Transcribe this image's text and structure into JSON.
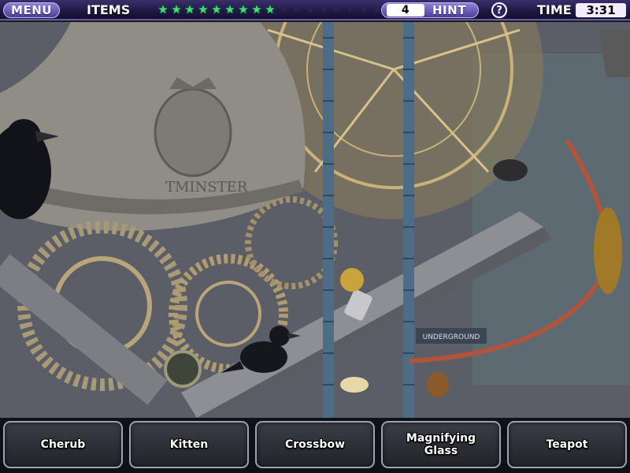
{
  "topbar": {
    "menu_label": "MENU",
    "items_label": "ITEMS",
    "stars_total": 18,
    "stars_filled": 9,
    "hint_count": "4",
    "hint_label": "HINT",
    "help_label": "?",
    "time_label": "TIME",
    "time_value": "3:31"
  },
  "scene": {
    "bell_text": "TMINSTER",
    "sign_text": "UNDERGROUND"
  },
  "items": [
    {
      "label": "Cherub"
    },
    {
      "label": "Kitten"
    },
    {
      "label": "Crossbow"
    },
    {
      "label": "Magnifying Glass"
    },
    {
      "label": "Teapot"
    }
  ],
  "colors": {
    "accent": "#6b5aa8",
    "star_on": "#3fe07a",
    "star_off": "#2a2548"
  }
}
